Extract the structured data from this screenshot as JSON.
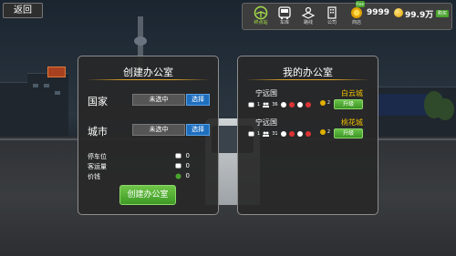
{
  "nav": {
    "back_label": "返回"
  },
  "topbar": {
    "items": [
      {
        "label": "终点站",
        "icon": "steering-wheel-icon",
        "active": true
      },
      {
        "label": "车库",
        "icon": "bus-icon"
      },
      {
        "label": "路线",
        "icon": "map-icon"
      },
      {
        "label": "公司",
        "icon": "building-icon"
      },
      {
        "label": "商店",
        "icon": "shop-icon"
      }
    ],
    "shop_badge": "free",
    "money": "9999",
    "gold": "99.9万",
    "add_label": "购买"
  },
  "create_panel": {
    "title": "创建办公室",
    "country_label": "国家",
    "country_value": "未选中",
    "city_label": "城市",
    "city_value": "未选中",
    "select_label": "选择",
    "stats": [
      {
        "label": "停车位",
        "value": "0"
      },
      {
        "label": "客运量",
        "value": "0"
      },
      {
        "label": "价钱",
        "value": "0"
      }
    ],
    "create_button": "创建办公室"
  },
  "offices_panel": {
    "title": "我的办公室",
    "offices": [
      {
        "country": "宁远国",
        "city": "白云城",
        "buses": "1",
        "riders": "36",
        "level": "2",
        "upgrade": "升级"
      },
      {
        "country": "宁远国",
        "city": "桃花城",
        "buses": "1",
        "riders": "31",
        "level": "2",
        "upgrade": "升级"
      }
    ]
  },
  "colors": {
    "accent_gold": "#f0c000",
    "button_green": "#4aa52e",
    "select_blue": "#1f6fbf"
  }
}
